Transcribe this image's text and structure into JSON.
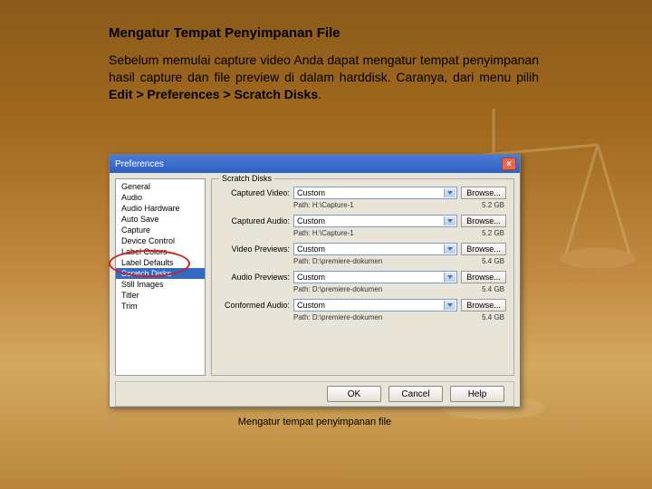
{
  "heading": "Mengatur Tempat Penyimpanan File",
  "body": "Sebelum memulai capture video Anda dapat mengatur tempat penyimpanan hasil capture dan file preview di dalam harddisk. Caranya, dari menu pilih ",
  "body_bold": "Edit > Preferences > Scratch Disks",
  "body_end": ".",
  "dialog": {
    "title": "Preferences",
    "group": "Scratch Disks",
    "sidebar": [
      "General",
      "Audio",
      "Audio Hardware",
      "Auto Save",
      "Capture",
      "Device Control",
      "Label Colors",
      "Label Defaults",
      "Scratch Disks",
      "Still Images",
      "Titler",
      "Trim"
    ],
    "selected_index": 8,
    "rows": [
      {
        "label": "Captured Video:",
        "value": "Custom",
        "path": "Path: H:\\Capture-1",
        "size": "5.2 GB"
      },
      {
        "label": "Captured Audio:",
        "value": "Custom",
        "path": "Path: H:\\Capture-1",
        "size": "5.2 GB"
      },
      {
        "label": "Video Previews:",
        "value": "Custom",
        "path": "Path: D:\\premiere-dokumen",
        "size": "5.4 GB"
      },
      {
        "label": "Audio Previews:",
        "value": "Custom",
        "path": "Path: D:\\premiere-dokumen",
        "size": "5.4 GB"
      },
      {
        "label": "Conformed Audio:",
        "value": "Custom",
        "path": "Path: D:\\premiere-dokumen",
        "size": "5.4 GB"
      }
    ],
    "browse": "Browse...",
    "buttons": {
      "ok": "OK",
      "cancel": "Cancel",
      "help": "Help"
    }
  },
  "caption": "Mengatur tempat penyimpanan file"
}
